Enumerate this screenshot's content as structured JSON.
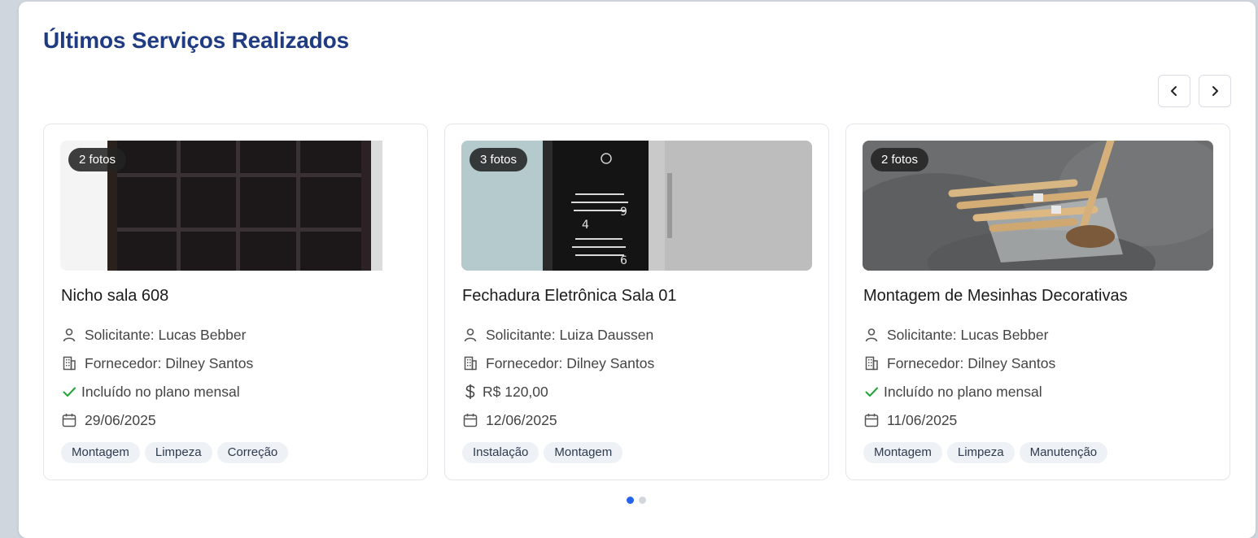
{
  "section": {
    "title": "Últimos Serviços Realizados"
  },
  "carousel": {
    "prev_icon": "chevron-left-icon",
    "next_icon": "chevron-right-icon",
    "pages": 2,
    "active_page": 1
  },
  "colors": {
    "title": "#1f3b82",
    "check": "#22a33a",
    "active_dot": "#2563eb",
    "tag_bg": "#eef1f6"
  },
  "cards": [
    {
      "photos_badge": "2 fotos",
      "title": "Nicho sala 608",
      "requester": "Solicitante: Lucas Bebber",
      "supplier": "Fornecedor: Dilney Santos",
      "billing": "Incluído no plano mensal",
      "billing_icon": "check-icon",
      "date": "29/06/2025",
      "tags": [
        "Montagem",
        "Limpeza",
        "Correção"
      ]
    },
    {
      "photos_badge": "3 fotos",
      "title": "Fechadura Eletrônica Sala 01",
      "requester": "Solicitante: Luiza Daussen",
      "supplier": "Fornecedor: Dilney Santos",
      "billing": "R$ 120,00",
      "billing_icon": "dollar-icon",
      "date": "12/06/2025",
      "tags": [
        "Instalação",
        "Montagem"
      ]
    },
    {
      "photos_badge": "2 fotos",
      "title": "Montagem de Mesinhas Decorativas",
      "requester": "Solicitante: Lucas Bebber",
      "supplier": "Fornecedor: Dilney Santos",
      "billing": "Incluído no plano mensal",
      "billing_icon": "check-icon",
      "date": "11/06/2025",
      "tags": [
        "Montagem",
        "Limpeza",
        "Manutenção"
      ]
    }
  ]
}
